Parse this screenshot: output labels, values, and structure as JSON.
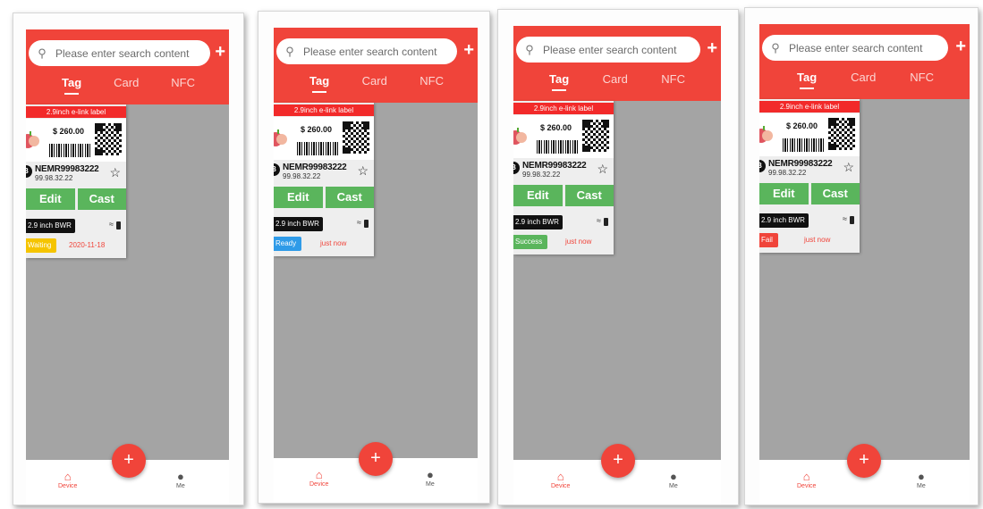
{
  "colors": {
    "brand": "#f0443a",
    "success": "#5ab55c",
    "content_bg": "#a4a4a4"
  },
  "screens": [
    {
      "search_placeholder": "Please enter search content",
      "tabs": [
        "Tag",
        "Card",
        "NFC"
      ],
      "card": {
        "ribbon": "2.9inch e-link label",
        "price": "$ 260.00",
        "badge_letter": "B",
        "device_name": "NEMR99983222",
        "device_ip": "99.98.32.22",
        "edit_label": "Edit",
        "cast_label": "Cast",
        "spec": "2.9 inch BWR",
        "status": "Waiting",
        "status_color": "#f5c400",
        "status_time": "2020-11-18"
      },
      "nav": {
        "home": "Device",
        "me": "Me"
      }
    },
    {
      "search_placeholder": "Please enter search content",
      "tabs": [
        "Tag",
        "Card",
        "NFC"
      ],
      "card": {
        "ribbon": "2.9inch e-link label",
        "price": "$ 260.00",
        "badge_letter": "B",
        "device_name": "NEMR99983222",
        "device_ip": "99.98.32.22",
        "edit_label": "Edit",
        "cast_label": "Cast",
        "spec": "2.9 inch BWR",
        "status": "Ready",
        "status_color": "#2f9be8",
        "status_time": "just now"
      },
      "nav": {
        "home": "Device",
        "me": "Me"
      }
    },
    {
      "search_placeholder": "Please enter search content",
      "tabs": [
        "Tag",
        "Card",
        "NFC"
      ],
      "card": {
        "ribbon": "2.9inch e-link label",
        "price": "$ 260.00",
        "badge_letter": "B",
        "device_name": "NEMR99983222",
        "device_ip": "99.98.32.22",
        "edit_label": "Edit",
        "cast_label": "Cast",
        "spec": "2.9 inch BWR",
        "status": "Success",
        "status_color": "#5ab55c",
        "status_time": "just now"
      },
      "nav": {
        "home": "Device",
        "me": "Me"
      }
    },
    {
      "search_placeholder": "Please enter search content",
      "tabs": [
        "Tag",
        "Card",
        "NFC"
      ],
      "card": {
        "ribbon": "2.9inch e-link label",
        "price": "$ 260.00",
        "badge_letter": "B",
        "device_name": "NEMR99983222",
        "device_ip": "99.98.32.22",
        "edit_label": "Edit",
        "cast_label": "Cast",
        "spec": "2.9 inch BWR",
        "status": "Fail",
        "status_color": "#f0443a",
        "status_time": "just now"
      },
      "nav": {
        "home": "Device",
        "me": "Me"
      }
    }
  ]
}
